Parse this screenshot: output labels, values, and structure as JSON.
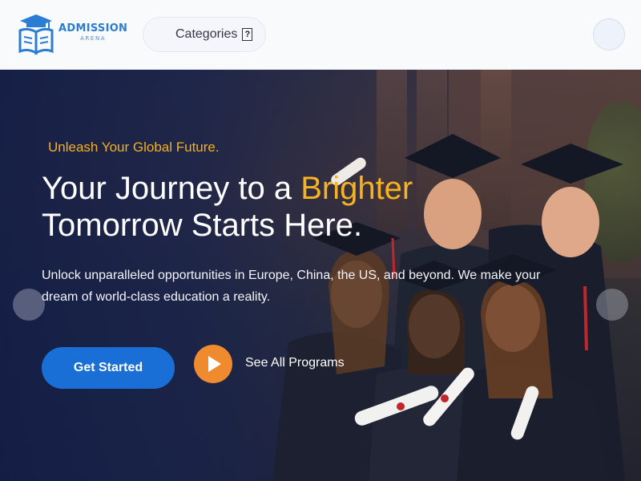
{
  "header": {
    "logo": {
      "title": "ADMISSION",
      "subtitle": "ARENA",
      "icon": "graduation-book-icon"
    },
    "categories": {
      "label": "Categories",
      "icon": "?"
    },
    "avatar": {
      "icon": "user-avatar"
    }
  },
  "hero": {
    "eyebrow": "Unleash Your Global Future.",
    "headline_part1": "Your Journey to a ",
    "headline_accent": "Brighter",
    "headline_part2": "Tomorrow Starts Here.",
    "description": "Unlock unparalleled opportunities in Europe, China, the US, and beyond. We make your dream of world-class education a reality.",
    "cta_primary": "Get Started",
    "cta_secondary": "See All Programs",
    "colors": {
      "accent": "#f5b323",
      "primary": "#1a6fd6",
      "play": "#f08a2e"
    }
  }
}
